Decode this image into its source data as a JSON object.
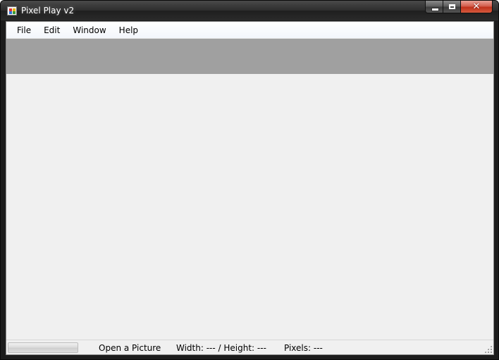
{
  "window": {
    "title": "Pixel Play v2",
    "close_symbol": "✕",
    "icons": {
      "app": "app-icon",
      "minimize": "minimize-icon",
      "maximize": "maximize-icon",
      "close": "close-icon"
    }
  },
  "menu": {
    "items": [
      "File",
      "Edit",
      "Window",
      "Help"
    ]
  },
  "colors": {
    "toolbar_panel": "#a0a0a0",
    "client_background": "#f0f0f0",
    "close_button": "#c0321c"
  },
  "statusbar": {
    "progress": 0,
    "status_message": "Open a Picture",
    "dimensions": "Width: --- / Height: ---",
    "pixels": "Pixels: ---"
  }
}
